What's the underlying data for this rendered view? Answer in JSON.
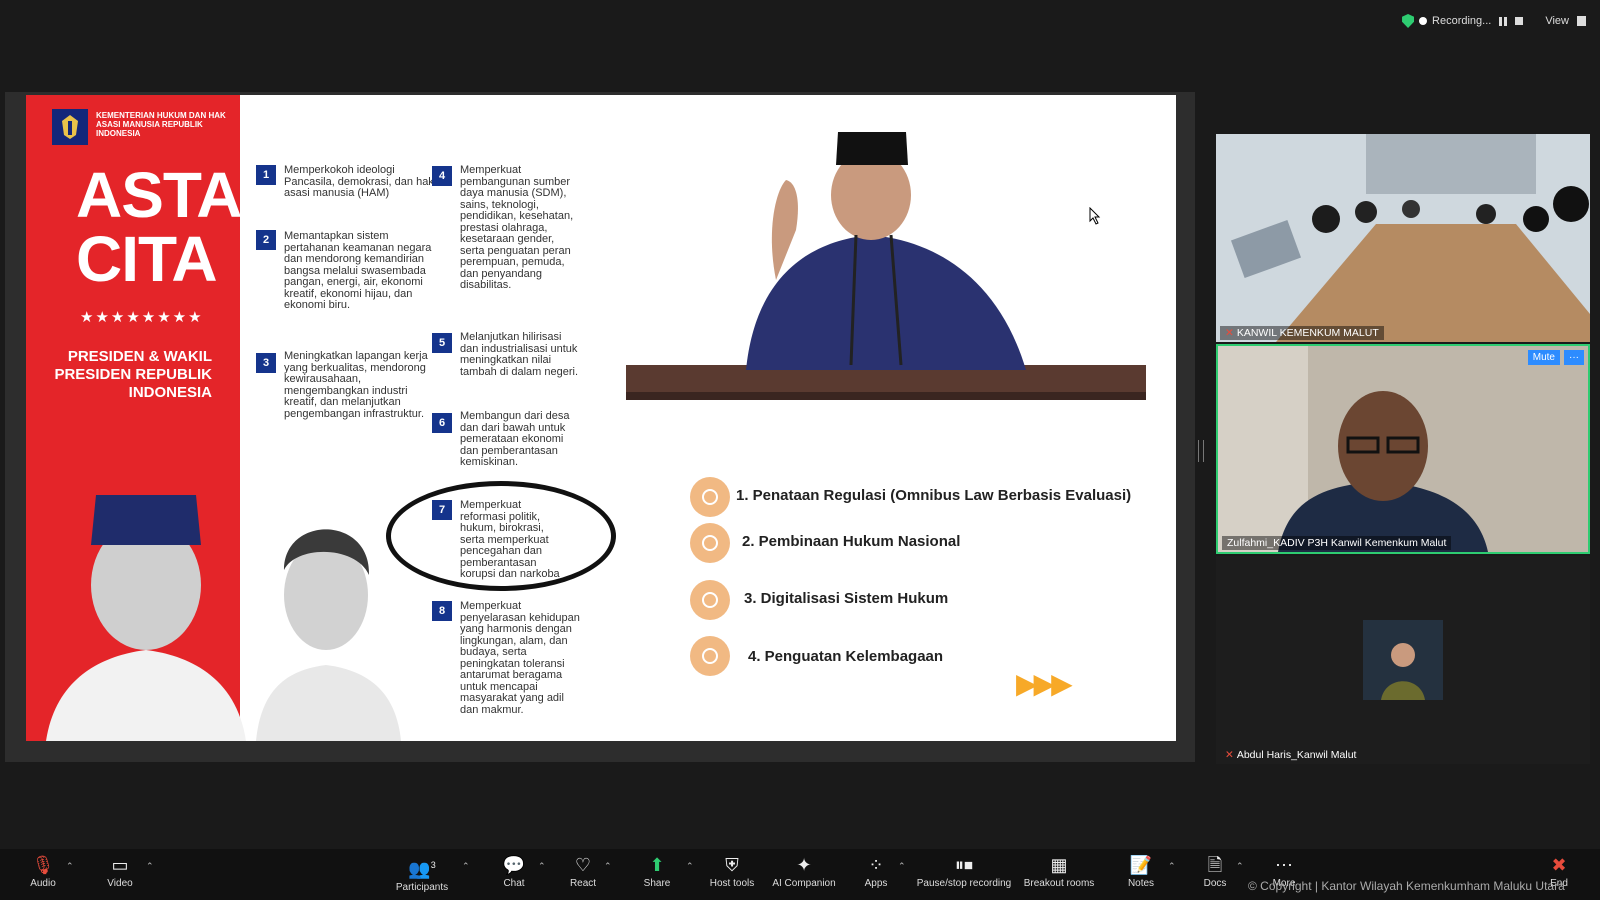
{
  "topbar": {
    "recording_label": "Recording...",
    "view_label": "View"
  },
  "slide": {
    "ministry": "KEMENTERIAN HUKUM DAN HAK ASASI MANUSIA REPUBLIK INDONESIA",
    "title_line1": "ASTA",
    "title_line2": "CITA",
    "stars": "★★★★★★★★",
    "president_text": "PRESIDEN & WAKIL PRESIDEN REPUBLIK INDONESIA",
    "items": [
      {
        "num": "1",
        "text": "Memperkokoh ideologi Pancasila, demokrasi, dan hak asasi manusia (HAM)"
      },
      {
        "num": "2",
        "text": "Memantapkan sistem pertahanan keamanan negara dan mendorong kemandirian bangsa melalui swasembada pangan, energi, air, ekonomi kreatif, ekonomi hijau, dan ekonomi biru."
      },
      {
        "num": "3",
        "text": "Meningkatkan lapangan kerja yang berkualitas, mendorong kewirausahaan, mengembangkan industri kreatif, dan melanjutkan pengembangan infrastruktur."
      },
      {
        "num": "4",
        "text": "Memperkuat pembangunan sumber daya manusia (SDM), sains, teknologi, pendidikan, kesehatan, prestasi olahraga, kesetaraan gender, serta penguatan peran perempuan, pemuda, dan penyandang disabilitas."
      },
      {
        "num": "5",
        "text": "Melanjutkan hilirisasi dan industrialisasi untuk meningkatkan nilai tambah di dalam negeri."
      },
      {
        "num": "6",
        "text": "Membangun dari desa dan dari bawah untuk pemerataan ekonomi dan pemberantasan kemiskinan."
      },
      {
        "num": "7",
        "text": "Memperkuat reformasi politik, hukum, birokrasi, serta memperkuat pencegahan dan pemberantasan korupsi dan narkoba"
      },
      {
        "num": "8",
        "text": "Memperkuat penyelarasan kehidupan yang harmonis dengan lingkungan, alam, dan budaya, serta peningkatan toleransi antarumat beragama untuk mencapai masyarakat yang adil dan makmur."
      }
    ],
    "agenda": [
      "1. Penataan Regulasi (Omnibus Law Berbasis Evaluasi)",
      "2. Pembinaan Hukum Nasional",
      "3. Digitalisasi Sistem Hukum",
      "4. Penguatan Kelembagaan"
    ],
    "arrows": "▶▶▶"
  },
  "participants_panel": {
    "tiles": [
      {
        "name": "KANWIL KEMENKUM MALUT"
      },
      {
        "name": "Zulfahmi_KADIV P3H Kanwil Kemenkum Malut",
        "mute_label": "Mute",
        "more_label": "···"
      },
      {
        "name": "Abdul Haris_Kanwil Malut"
      }
    ]
  },
  "toolbar": {
    "audio": "Audio",
    "video": "Video",
    "participants": "Participants",
    "participants_count": "3",
    "chat": "Chat",
    "react": "React",
    "share": "Share",
    "host_tools": "Host tools",
    "ai_companion": "AI Companion",
    "apps": "Apps",
    "pause_recording": "Pause/stop recording",
    "breakout": "Breakout rooms",
    "notes": "Notes",
    "docs": "Docs",
    "more": "More",
    "end": "End"
  },
  "footer": "© Copyright | Kantor Wilayah Kemenkumham Maluku Utara"
}
